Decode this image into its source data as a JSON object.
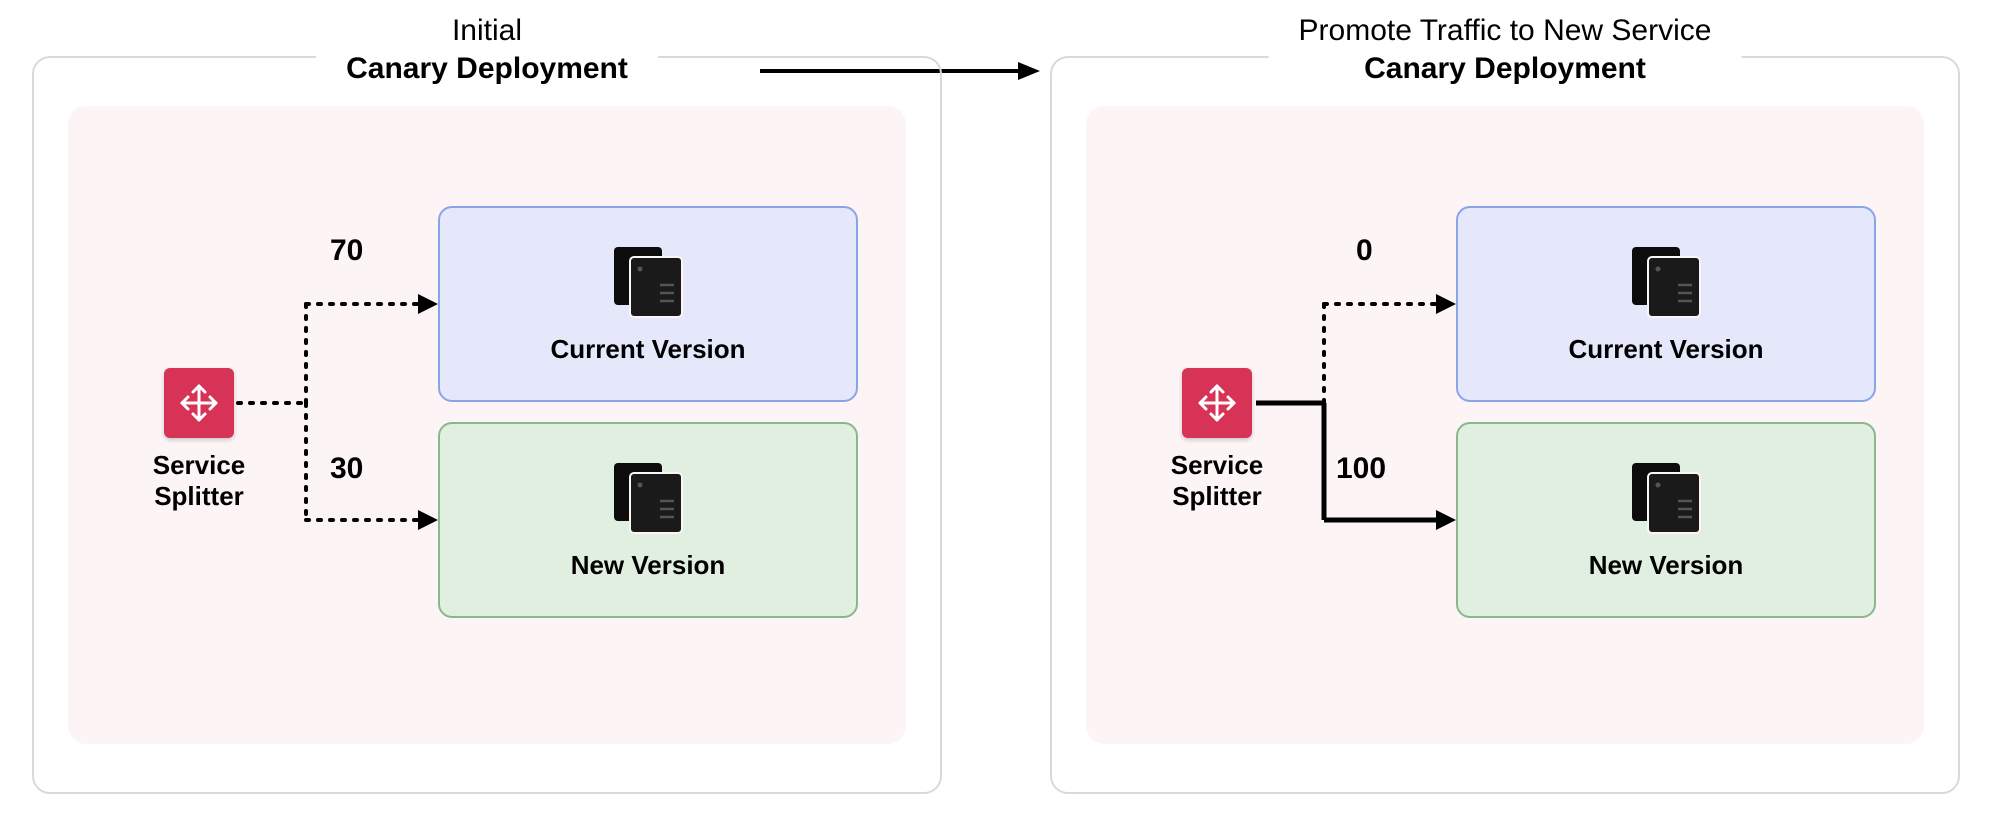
{
  "left": {
    "supertitle": "Initial",
    "title": "Canary Deployment",
    "splitter_label": "Service Splitter",
    "current_label": "Current Version",
    "new_label": "New Version",
    "weight_current": "70",
    "weight_new": "30"
  },
  "right": {
    "supertitle": "Promote Traffic to New Service",
    "title": "Canary Deployment",
    "splitter_label": "Service Splitter",
    "current_label": "Current Version",
    "new_label": "New Version",
    "weight_current": "0",
    "weight_new": "100"
  }
}
